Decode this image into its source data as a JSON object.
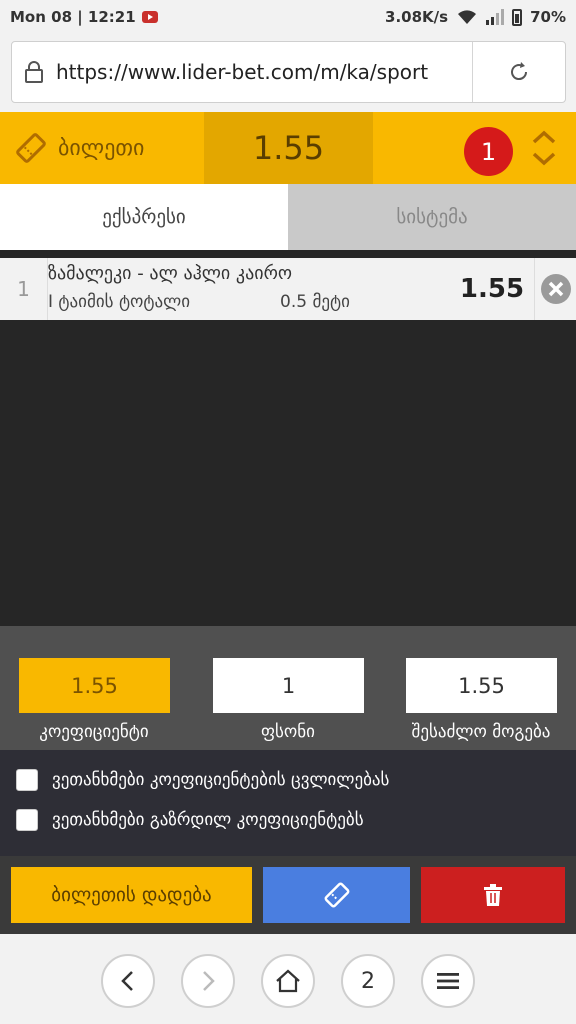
{
  "status_bar": {
    "time": "Mon 08 | 12:21",
    "net_speed": "3.08K/s",
    "battery": "70%"
  },
  "browser": {
    "url": "https://www.lider-bet.com/m/ka/sport"
  },
  "ticket": {
    "title": "ბილეთი",
    "total_odds": "1.55",
    "count": "1"
  },
  "tabs": {
    "express": "ექსპრესი",
    "system": "სისტემა"
  },
  "bet": {
    "number": "1",
    "match": "ზამალეკი - ალ აჰლი კაირო",
    "market": "I ტაიმის ტოტალი",
    "selection": "0.5 მეტი",
    "odds": "1.55"
  },
  "stake": {
    "odds_value": "1.55",
    "amount_value": "1",
    "win_value": "1.55",
    "odds_label": "კოეფიციენტი",
    "amount_label": "ფსონი",
    "win_label": "შესაძლო მოგება"
  },
  "options": {
    "accept_changes": "ვეთანხმები კოეფიციენტების ცვლილებას",
    "accept_boosted": "ვეთანხმები გაზრდილ კოეფიციენტებს"
  },
  "actions": {
    "place_bet": "ბილეთის დადება"
  },
  "nav": {
    "tabs_count": "2"
  },
  "colors": {
    "brand_yellow": "#f9b800",
    "badge_red": "#d51a1a",
    "blue": "#4a7ee0",
    "delete_red": "#cc1f1f"
  }
}
